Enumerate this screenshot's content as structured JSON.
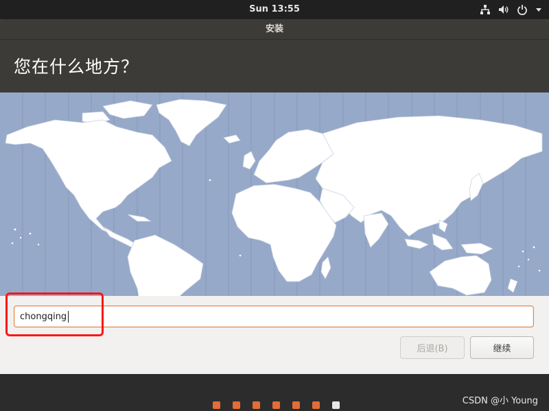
{
  "panel": {
    "clock": "Sun 13:55",
    "tray_icons": [
      "network-icon",
      "volume-icon",
      "power-icon",
      "chevron-down-icon"
    ]
  },
  "window": {
    "title": "安装",
    "heading": "您在什么地方？"
  },
  "location": {
    "value": "chongqing"
  },
  "buttons": {
    "back": "后退(B)",
    "continue": "继续"
  },
  "progress": {
    "total_steps": 7,
    "current_step": 7
  },
  "watermark": "CSDN @小 Young",
  "colors": {
    "accent": "#e26d36",
    "map_water": "#96a9c9",
    "annotation": "#ff1414",
    "header": "#3d3b37"
  }
}
